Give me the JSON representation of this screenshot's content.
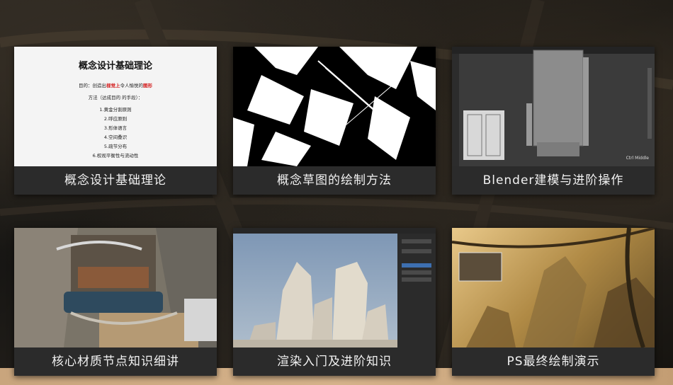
{
  "cards": [
    {
      "label": "概念设计基础理论",
      "doc": {
        "title": "概念设计基础理论",
        "purpose_prefix": "目的：创造出",
        "purpose_red1": "视觉上",
        "purpose_mid": "令人愉悦的",
        "purpose_red2": "图形",
        "method": "方法（达成目的 的手段）：",
        "items": [
          "1.黄金分割原则",
          "2.呼应原则",
          "3.形体语言",
          "4.空间叠识",
          "5.疏节分布",
          "6.权视平衡性与流动性"
        ]
      }
    },
    {
      "label": "概念草图的绘制方法"
    },
    {
      "label": "Blender建模与进阶操作",
      "overlay": "Ctrl Middle"
    },
    {
      "label": "核心材质节点知识细讲"
    },
    {
      "label": "渲染入门及进阶知识"
    },
    {
      "label": "PS最终绘制演示"
    }
  ],
  "colors": {
    "label_bg": "#2b2b2b",
    "label_text": "#f2f2f2",
    "accent_red": "#d21818",
    "floor": "#d6b38b"
  }
}
